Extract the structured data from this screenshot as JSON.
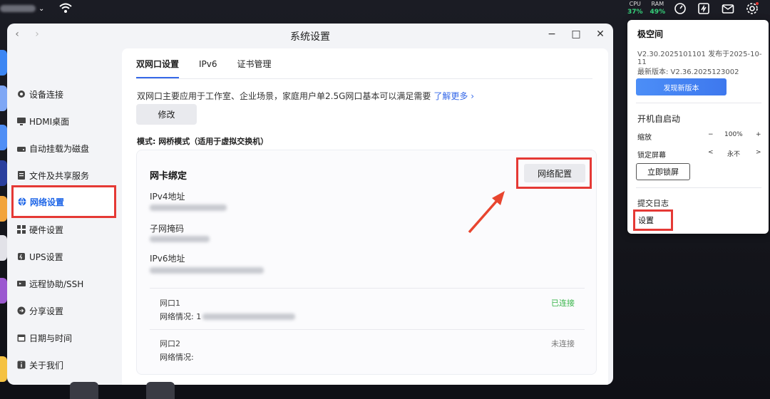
{
  "topbar": {
    "metrics": [
      {
        "label": "CPU",
        "value": "37%"
      },
      {
        "label": "RAM",
        "value": "49%"
      }
    ],
    "icons": [
      "gauge-icon",
      "monitor-icon",
      "mail-icon",
      "gear-icon"
    ]
  },
  "window": {
    "title": "系统设置",
    "back": "‹",
    "forward": "›",
    "minimize": "−",
    "maximize": "□",
    "close": "✕"
  },
  "sidebar": {
    "items": [
      {
        "label": "设备连接",
        "icon": "link-icon"
      },
      {
        "label": "HDMI桌面",
        "icon": "display-icon"
      },
      {
        "label": "自动挂载为磁盘",
        "icon": "disk-icon"
      },
      {
        "label": "文件及共享服务",
        "icon": "file-icon"
      },
      {
        "label": "网络设置",
        "icon": "globe-icon",
        "active": true
      },
      {
        "label": "硬件设置",
        "icon": "grid-icon"
      },
      {
        "label": "UPS设置",
        "icon": "ups-icon"
      },
      {
        "label": "远程协助/SSH",
        "icon": "remote-icon"
      },
      {
        "label": "分享设置",
        "icon": "share-icon"
      },
      {
        "label": "日期与时间",
        "icon": "calendar-icon"
      },
      {
        "label": "关于我们",
        "icon": "info-icon"
      }
    ]
  },
  "content": {
    "tabs": [
      "双网口设置",
      "IPv6",
      "证书管理"
    ],
    "intro": "双网口主要应用于工作室、企业场景，家庭用户单2.5G网口基本可以满足需要",
    "intro_link": "了解更多 ›",
    "modify_button": "修改",
    "mode": "模式: 网桥模式（适用于虚拟交换机）",
    "card": {
      "title": "网卡绑定",
      "config_button": "网络配置",
      "fields": {
        "ipv4": "IPv4地址",
        "subnet": "子网掩码",
        "ipv6": "IPv6地址"
      },
      "ports": [
        {
          "name": "网口1",
          "status": "已连接",
          "detail_label": "网络情况:",
          "detail_value": "1"
        },
        {
          "name": "网口2",
          "status": "未连接",
          "detail_label": "网络情况:",
          "detail_value": ""
        }
      ]
    }
  },
  "popup": {
    "title": "极空间",
    "version_line": "V2.30.2025101101 发布于2025-10-11",
    "latest_line": "最新版本: V2.36.2025123002",
    "update_button": "发现新版本",
    "autostart": "开机自启动",
    "zoom": {
      "label": "缩放",
      "minus": "−",
      "value": "100%",
      "plus": "+"
    },
    "lock": {
      "label": "锁定屏幕",
      "prev": "<",
      "value": "永不",
      "next": ">"
    },
    "lock_button": "立即锁屏",
    "submit_log": "提交日志",
    "settings": "设置"
  },
  "colors": {
    "accent": "#3568e8",
    "highlight": "#e53935",
    "connected": "#39b54a",
    "metric": "#36d07a"
  }
}
